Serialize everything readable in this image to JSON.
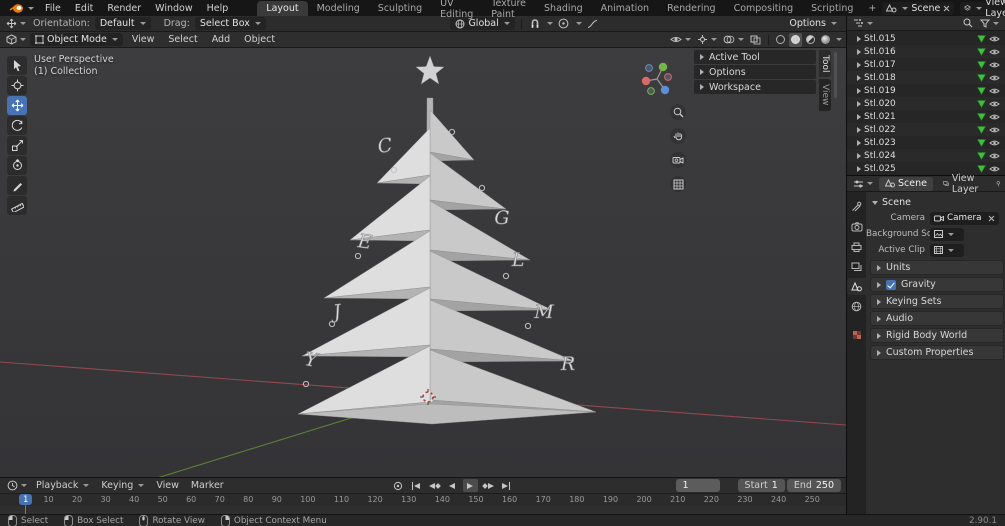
{
  "topbar": {
    "menus": [
      "File",
      "Edit",
      "Render",
      "Window",
      "Help"
    ],
    "tabs": [
      "Layout",
      "Modeling",
      "Sculpting",
      "UV Editing",
      "Texture Paint",
      "Shading",
      "Animation",
      "Rendering",
      "Compositing",
      "Scripting"
    ],
    "active_tab": "Layout",
    "add_tab": "+",
    "scene_selector": "Scene",
    "view_layer_selector": "View Layer"
  },
  "tool_settings": {
    "orientation_label": "Orientation:",
    "orientation_value": "Default",
    "drag_label": "Drag:",
    "drag_value": "Select Box",
    "transform_orientation": "Global",
    "options_label": "Options"
  },
  "viewport": {
    "mode": "Object Mode",
    "menus": [
      "View",
      "Select",
      "Add",
      "Object"
    ],
    "overlay_line1": "User Perspective",
    "overlay_line2": "(1) Collection",
    "tools": [
      "select-box",
      "cursor",
      "move",
      "rotate",
      "scale",
      "transform",
      "annotate",
      "measure"
    ],
    "active_tool": "move",
    "nav_icons": [
      "zoom",
      "pan",
      "camera-view",
      "toggle-orthographic"
    ],
    "shading_modes": [
      "wireframe",
      "solid",
      "material-preview",
      "rendered"
    ],
    "active_shading": "solid",
    "sidebar_panels": [
      "Active Tool",
      "Options",
      "Workspace"
    ],
    "sidebar_tabs": [
      "Tool",
      "View"
    ],
    "active_sidebar_tab": "Tool",
    "ornament_letters": [
      "C",
      "G",
      "E",
      "L",
      "J",
      "M",
      "Y",
      "R"
    ]
  },
  "outliner": {
    "items": [
      "Stl.015",
      "Stl.016",
      "Stl.017",
      "Stl.018",
      "Stl.019",
      "Stl.020",
      "Stl.021",
      "Stl.022",
      "Stl.023",
      "Stl.024",
      "Stl.025"
    ]
  },
  "properties": {
    "tabs": [
      "Scene",
      "View Layer"
    ],
    "active_tab": "Scene",
    "nav_tabs": [
      "tool",
      "render",
      "output",
      "view-layer",
      "scene",
      "world",
      "texture"
    ],
    "active_nav_tab": "scene",
    "panel_title": "Scene",
    "camera_label": "Camera",
    "camera_value": "Camera",
    "background_label": "Background Sc...",
    "active_clip_label": "Active Clip",
    "collapsed_panels": [
      "Units",
      "Gravity",
      "Keying Sets",
      "Audio",
      "Rigid Body World",
      "Custom Properties"
    ],
    "gravity_enabled": true
  },
  "timeline": {
    "menus": [
      "Playback",
      "Keying",
      "View",
      "Marker"
    ],
    "transport": [
      "auto-keying",
      "jump-to-start",
      "jump-to-previous-keyframe",
      "play-reverse",
      "play",
      "jump-to-next-keyframe",
      "jump-to-end"
    ],
    "current_frame": "1",
    "start_label": "Start",
    "start_value": "1",
    "end_label": "End",
    "end_value": "250",
    "ticks": [
      "1",
      "10",
      "20",
      "30",
      "40",
      "50",
      "60",
      "70",
      "80",
      "90",
      "100",
      "110",
      "120",
      "130",
      "140",
      "150",
      "160",
      "170",
      "180",
      "190",
      "200",
      "210",
      "220",
      "230",
      "240",
      "250"
    ]
  },
  "status_bar": {
    "items": [
      "Select",
      "Box Select",
      "Rotate View",
      "Object Context Menu"
    ],
    "version": "2.90.1"
  },
  "colors": {
    "accent": "#4772b3",
    "axis_x": "#9c4a52",
    "axis_y": "#5f8a37",
    "mesh_icon_green": "#3fbf3f"
  }
}
